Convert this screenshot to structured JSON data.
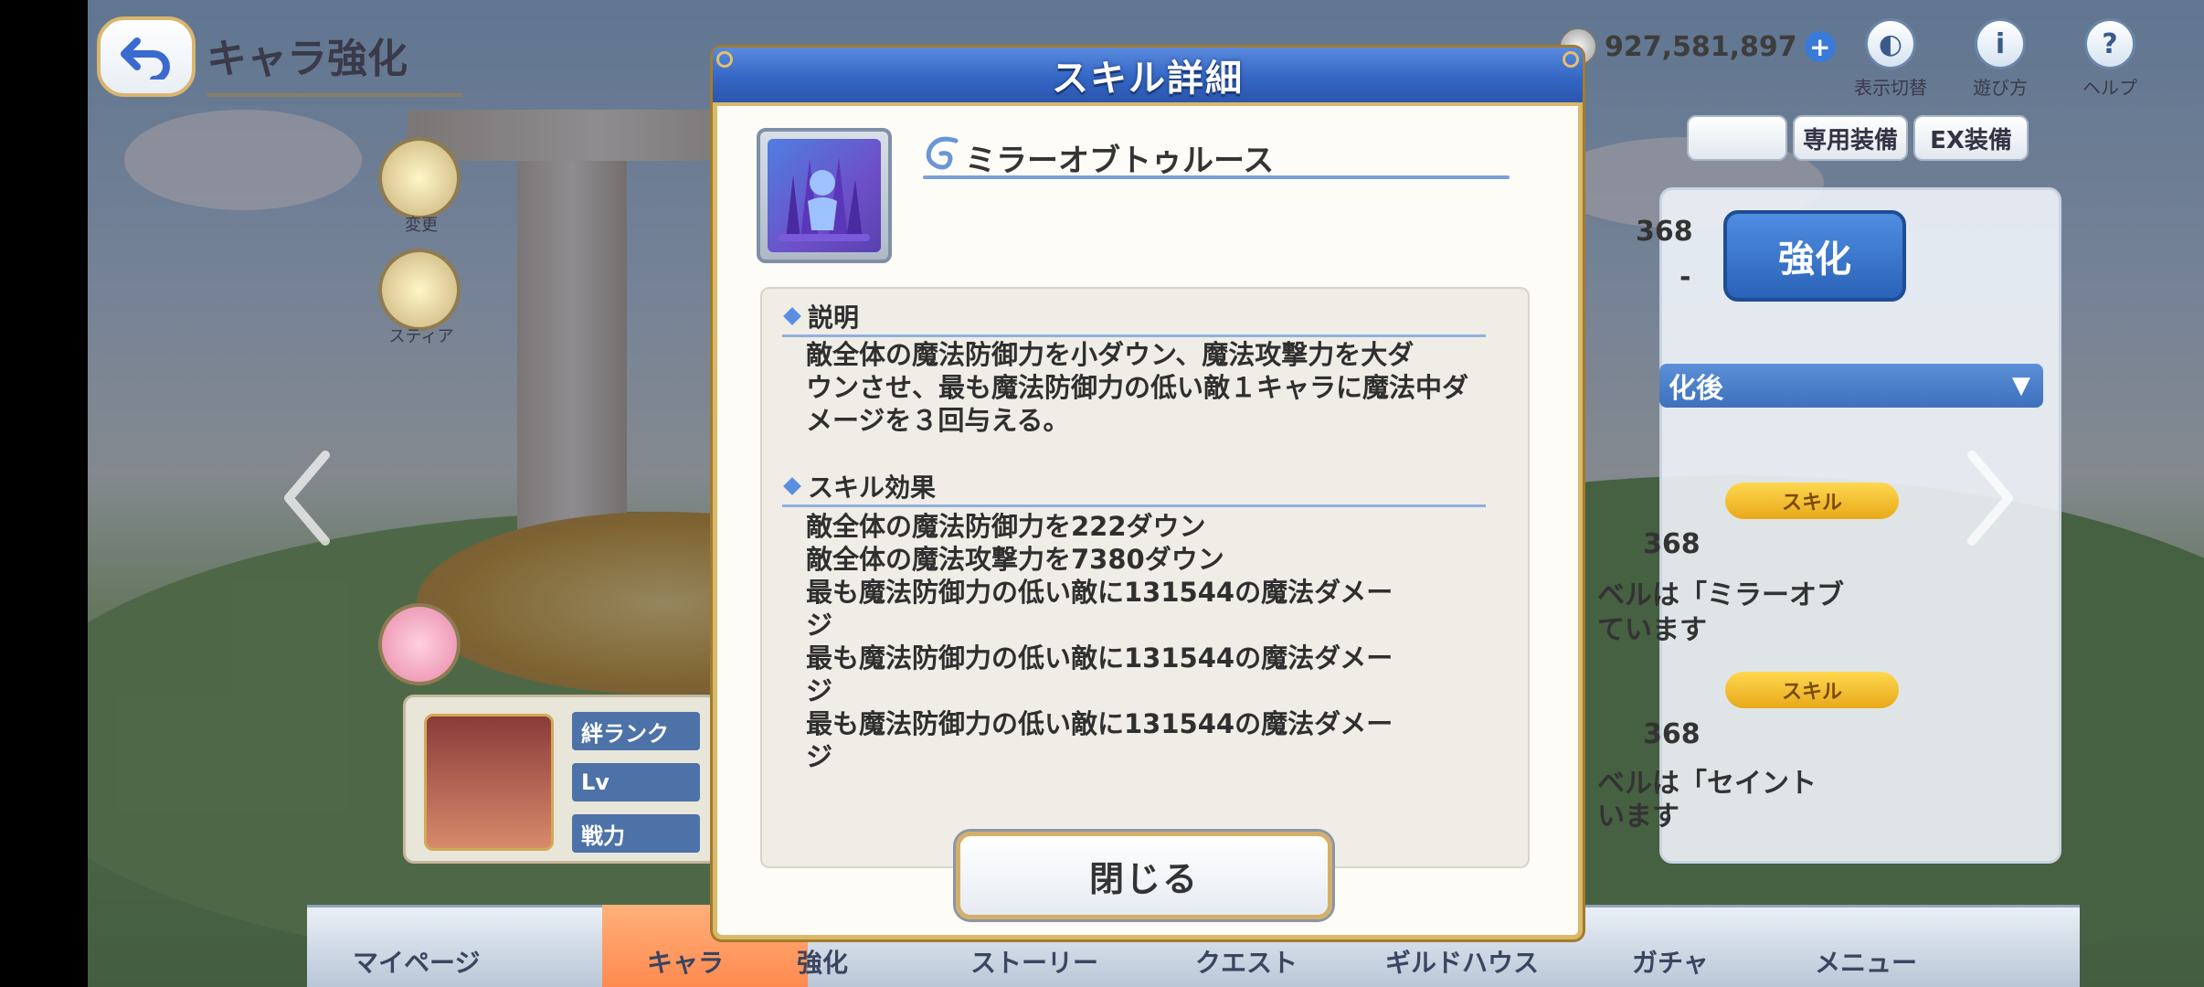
{
  "screen": {
    "title": "キャラ強化",
    "money": "927,581,897",
    "top_icons": [
      {
        "label": "表示切替",
        "icon": "toggle-view-icon"
      },
      {
        "label": "遊び方",
        "icon": "info-icon"
      },
      {
        "label": "ヘルプ",
        "icon": "help-icon"
      }
    ],
    "tabs": [
      "専用装備",
      "EX装備"
    ],
    "right_panel": {
      "value_top": "368",
      "value_dash": "-",
      "enhance_label": "強化",
      "dropdown_label": "化後",
      "skill_badge": "スキル",
      "row1_value": "368",
      "row1_text_a": "ベルは「ミラーオブ",
      "row1_text_b": "ています",
      "row2_value": "368",
      "row2_text_a": "ベルは「セイント",
      "row2_text_b": "います"
    },
    "left_labels": [
      "変更",
      "スティア"
    ],
    "char_card": {
      "tags": [
        "絆ランク",
        "Lv",
        "戦力"
      ]
    },
    "bottom_nav": [
      "マイページ",
      "キャラ",
      "強化",
      "ストーリー",
      "クエスト",
      "ギルドハウス",
      "ガチャ",
      "メニュー"
    ]
  },
  "modal": {
    "title": "スキル詳細",
    "skill_name": "ミラーオブトゥルース",
    "description_heading": "説明",
    "description": [
      "敵全体の魔法防御力を小ダウン、魔法攻撃力を大ダ",
      "ウンさせ、最も魔法防御力の低い敵１キャラに魔法中ダ",
      "メージを３回与える。"
    ],
    "effects_heading": "スキル効果",
    "effects": [
      "敵全体の魔法防御力を222ダウン",
      "敵全体の魔法攻撃力を7380ダウン",
      "最も魔法防御力の低い敵に131544の魔法ダメー",
      "ジ",
      "最も魔法防御力の低い敵に131544の魔法ダメー",
      "ジ",
      "最も魔法防御力の低い敵に131544の魔法ダメー",
      "ジ"
    ],
    "close_label": "閉じる"
  },
  "colors": {
    "header_blue": "#3466c4",
    "gold_frame": "#d9b86a",
    "accent_line": "#8fb0e0"
  }
}
